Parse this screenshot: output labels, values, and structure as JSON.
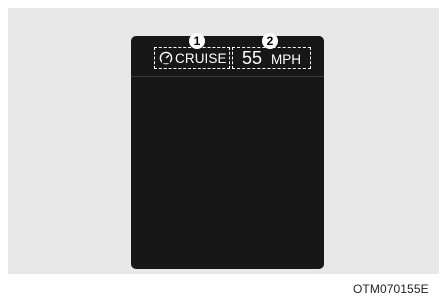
{
  "display": {
    "cruise_label": "CRUISE",
    "set_speed_value": "55",
    "set_speed_unit": "MPH",
    "cruise_icon": "speedometer-icon"
  },
  "callouts": {
    "first": "1",
    "second": "2"
  },
  "figure": {
    "code": "OTM070155E"
  },
  "colors": {
    "panel_background": "#e8e8e8",
    "screen_background": "#171717",
    "indicator_text": "#ffffff"
  }
}
